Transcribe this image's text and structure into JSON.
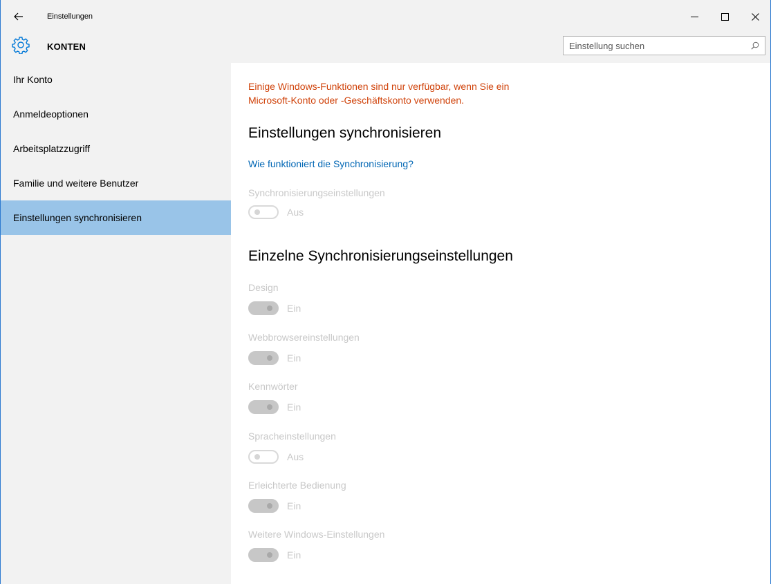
{
  "window": {
    "app_title": "Einstellungen",
    "minimize_label": "",
    "maximize_label": "",
    "close_label": ""
  },
  "header": {
    "section_title": "KONTEN",
    "icon": "gear-icon"
  },
  "search": {
    "placeholder": "Einstellung suchen",
    "value": "",
    "icon": "search-icon"
  },
  "sidebar": {
    "items": [
      {
        "label": "Ihr Konto",
        "active": false
      },
      {
        "label": "Anmeldeoptionen",
        "active": false
      },
      {
        "label": "Arbeitsplatzzugriff",
        "active": false
      },
      {
        "label": "Familie und weitere Benutzer",
        "active": false
      },
      {
        "label": "Einstellungen synchronisieren",
        "active": true
      }
    ]
  },
  "main": {
    "warning": "Einige Windows-Funktionen sind nur verfügbar, wenn Sie ein Microsoft-Konto oder -Geschäftskonto verwenden.",
    "heading_sync": "Einstellungen synchronisieren",
    "help_link": "Wie funktioniert die Synchronisierung?",
    "sync_settings": {
      "label": "Synchronisierungseinstellungen",
      "state": "Aus"
    },
    "heading_individual": "Einzelne Synchronisierungseinstellungen",
    "individual": [
      {
        "label": "Design",
        "state": "Ein"
      },
      {
        "label": "Webbrowsereinstellungen",
        "state": "Ein"
      },
      {
        "label": "Kennwörter",
        "state": "Ein"
      },
      {
        "label": "Spracheinstellungen",
        "state": "Aus"
      },
      {
        "label": "Erleichterte Bedienung",
        "state": "Ein"
      },
      {
        "label": "Weitere Windows-Einstellungen",
        "state": "Ein"
      }
    ]
  },
  "colors": {
    "accent_selected": "#99c4e8",
    "warning_text": "#d0430b",
    "link_text": "#0066b4",
    "disabled_text": "#c8c8c8",
    "chrome_bg": "#f2f2f2",
    "gear_icon": "#0078d7"
  }
}
